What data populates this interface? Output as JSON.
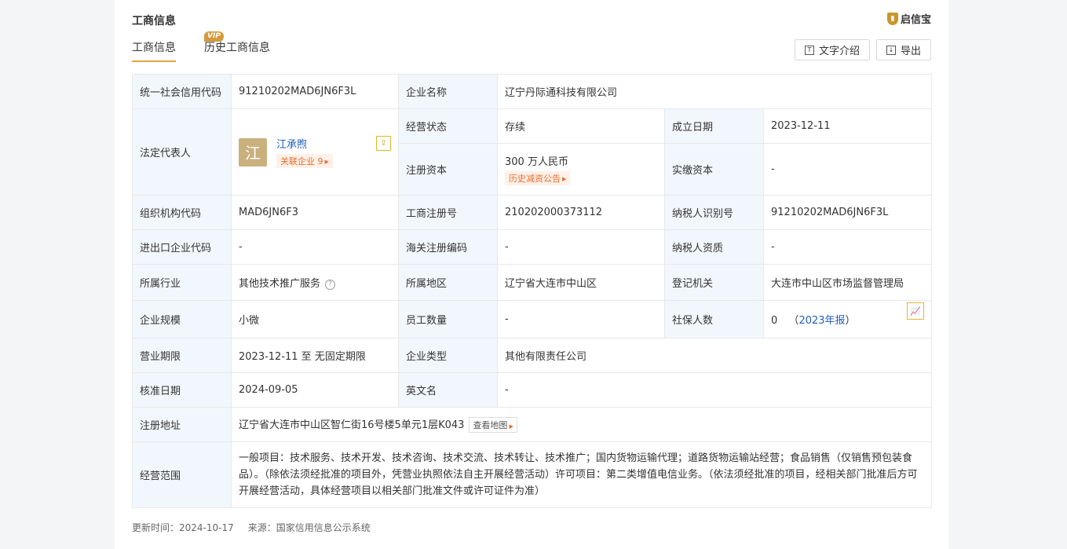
{
  "header": {
    "title": "工商信息",
    "brand": "启信宝"
  },
  "tabs": [
    {
      "label": "工商信息",
      "active": true
    },
    {
      "label": "历史工商信息",
      "badge": "VIP"
    }
  ],
  "actions": {
    "text_intro": "文字介绍",
    "export": "导出"
  },
  "fields": {
    "credit_code_label": "统一社会信用代码",
    "credit_code": "91210202MAD6JN6F3L",
    "company_name_label": "企业名称",
    "company_name": "辽宁丹际通科技有限公司",
    "legal_rep_label": "法定代表人",
    "legal_rep_avatar": "江",
    "legal_rep_name": "江承煦",
    "legal_rep_related": "关联企业 9",
    "status_label": "经营状态",
    "status": "存续",
    "founded_label": "成立日期",
    "founded": "2023-12-11",
    "reg_capital_label": "注册资本",
    "reg_capital": "300 万人民币",
    "reg_capital_history": "历史减资公告",
    "paid_capital_label": "实缴资本",
    "paid_capital": "-",
    "org_code_label": "组织机构代码",
    "org_code": "MAD6JN6F3",
    "reg_no_label": "工商注册号",
    "reg_no": "210202000373112",
    "taxpayer_id_label": "纳税人识别号",
    "taxpayer_id": "91210202MAD6JN6F3L",
    "import_export_label": "进出口企业代码",
    "import_export": "-",
    "customs_label": "海关注册编码",
    "customs": "-",
    "taxpayer_qual_label": "纳税人资质",
    "taxpayer_qual": "-",
    "industry_label": "所属行业",
    "industry": "其他技术推广服务",
    "region_label": "所属地区",
    "region": "辽宁省大连市中山区",
    "authority_label": "登记机关",
    "authority": "大连市中山区市场监督管理局",
    "scale_label": "企业规模",
    "scale": "小微",
    "employees_label": "员工数量",
    "employees": "-",
    "insured_label": "社保人数",
    "insured": "0",
    "insured_report": "2023年报",
    "term_label": "营业期限",
    "term": "2023-12-11 至 无固定期限",
    "type_label": "企业类型",
    "type": "其他有限责任公司",
    "approved_label": "核准日期",
    "approved": "2024-09-05",
    "english_name_label": "英文名",
    "english_name": "-",
    "address_label": "注册地址",
    "address": "辽宁省大连市中山区智仁街16号楼5单元1层K043",
    "view_map": "查看地图",
    "scope_label": "经营范围",
    "scope": "一般项目：技术服务、技术开发、技术咨询、技术交流、技术转让、技术推广；国内货物运输代理；道路货物运输站经营；食品销售（仅销售预包装食品）。（除依法须经批准的项目外，凭营业执照依法自主开展经营活动）许可项目：第二类增值电信业务。（依法须经批准的项目，经相关部门批准后方可开展经营活动，具体经营项目以相关部门批准文件或许可证件为准）"
  },
  "footer": {
    "updated": "更新时间：2024-10-17",
    "source": "来源：国家信用信息公示系统"
  },
  "colors": {
    "accent": "#e6a33c",
    "link": "#1f5fbd",
    "label_bg": "#f2f7fd",
    "tag": "#e86b2c"
  }
}
